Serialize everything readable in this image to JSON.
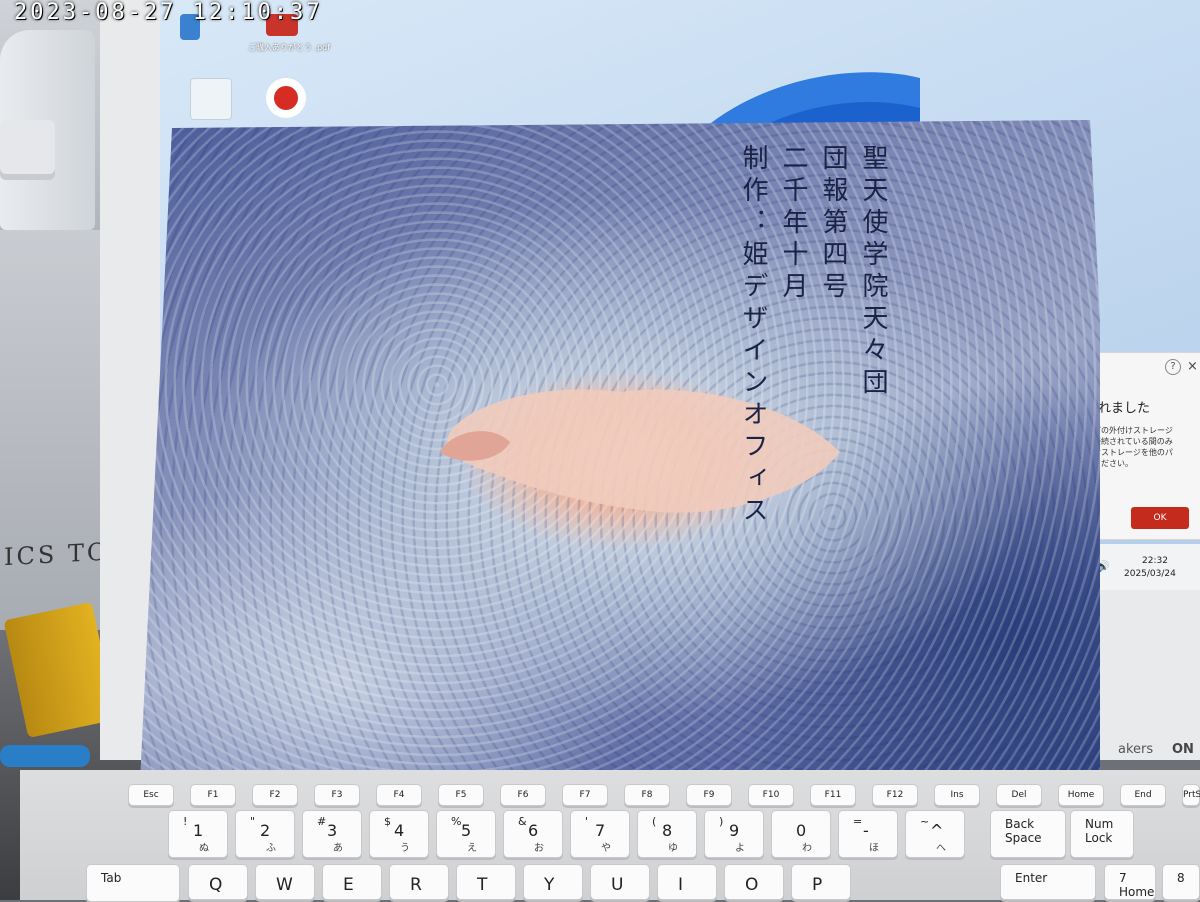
{
  "overlay": {
    "timestamp": "2023-08-27 12:10:37"
  },
  "desktop": {
    "icon_label": "ご購入ありがとう\n.pdf",
    "dialog": {
      "help": "?",
      "close": "×",
      "title": "されました",
      "body": "などの外付けストレージ\nに接続されている間のみ\n付けストレージを他のパ\nせください。",
      "ok": "OK"
    },
    "tray": {
      "time": "22:32",
      "date": "2025/03/24"
    },
    "brand_text": "akers",
    "brand_logo": "ON",
    "box_label": "ICS TO"
  },
  "card": {
    "columns": [
      "聖天使学院天々団",
      "団報第四号",
      "二千年十月",
      "制作：姫デザインオフィス"
    ]
  },
  "keyboard": {
    "function_keys": [
      "Esc",
      "F1",
      "F2",
      "F3",
      "F4",
      "F5",
      "F6",
      "F7",
      "F8",
      "F9",
      "F10",
      "F11",
      "F12",
      "Ins",
      "Del",
      "Home",
      "End",
      "PrtSc"
    ],
    "number_row": [
      {
        "main": "1",
        "shift": "!",
        "kana": "ぬ"
      },
      {
        "main": "2",
        "shift": "\"",
        "kana": "ふ"
      },
      {
        "main": "3",
        "shift": "#",
        "kana": "あ"
      },
      {
        "main": "4",
        "shift": "$",
        "kana": "う"
      },
      {
        "main": "5",
        "shift": "%",
        "kana": "え"
      },
      {
        "main": "6",
        "shift": "&",
        "kana": "お"
      },
      {
        "main": "7",
        "shift": "'",
        "kana": "や"
      },
      {
        "main": "8",
        "shift": "(",
        "kana": "ゆ"
      },
      {
        "main": "9",
        "shift": ")",
        "kana": "よ"
      },
      {
        "main": "0",
        "shift": "",
        "kana": "わ"
      },
      {
        "main": "-",
        "shift": "=",
        "kana": "ほ"
      },
      {
        "main": "^",
        "shift": "~",
        "kana": "へ"
      }
    ],
    "backspace": "Back\nSpace",
    "numlock": "Num\nLock",
    "alpha_row": [
      "Q",
      "W",
      "E",
      "R",
      "T",
      "Y",
      "U",
      "I",
      "O",
      "P"
    ],
    "tab": "Tab",
    "enter": "Enter",
    "numpad_7": "7",
    "numpad_7_sub": "Home",
    "numpad_8": "8"
  }
}
